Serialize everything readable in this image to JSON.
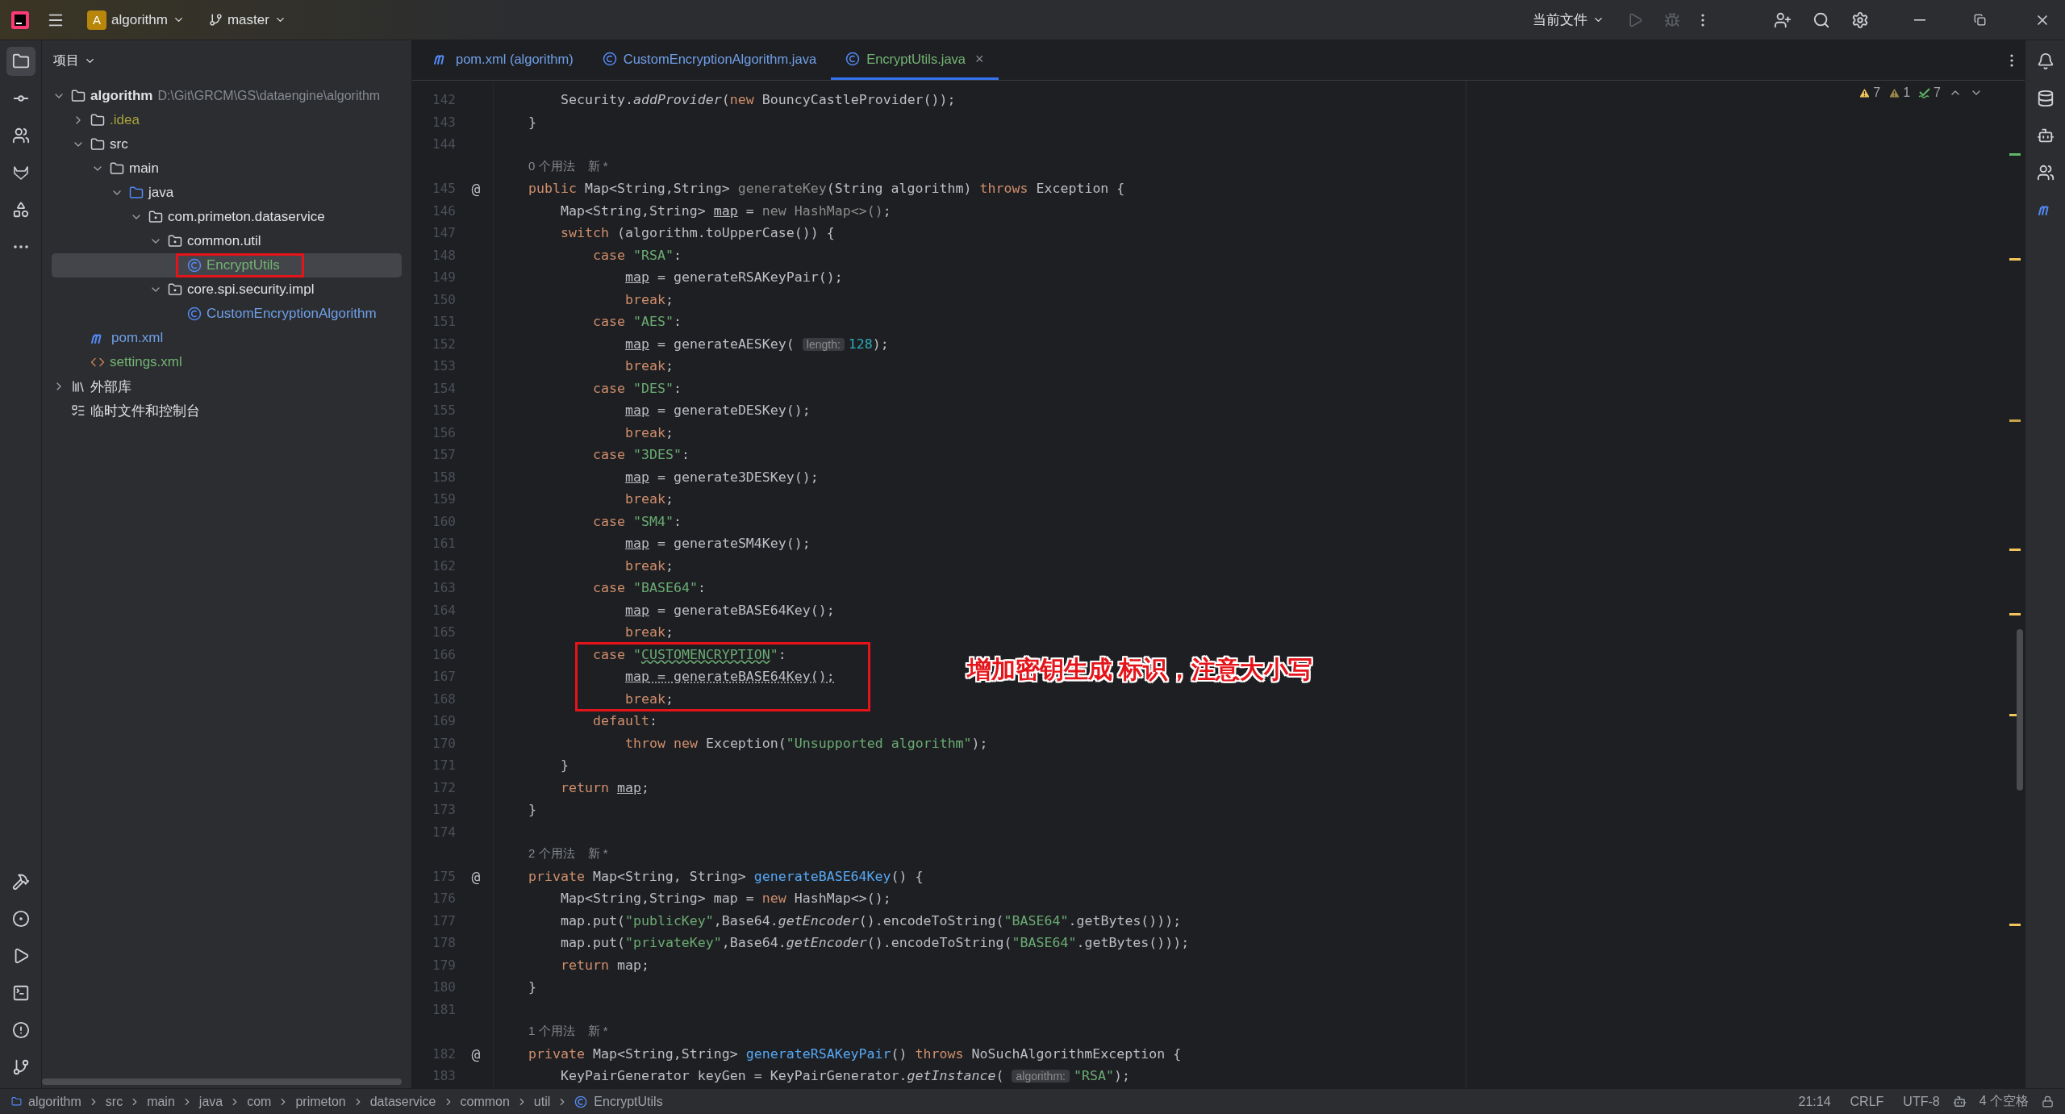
{
  "title_bar": {
    "project_badge": "A",
    "project": "algorithm",
    "branch": "master",
    "run_config": "当前文件"
  },
  "project_panel": {
    "title": "项目",
    "tree": [
      {
        "name": "algorithm",
        "path": "D:\\Git\\GRCM\\GS\\dataengine\\algorithm",
        "kind": "module",
        "color": "#dfe1e5",
        "expanded": true,
        "selected": false,
        "children": [
          {
            "name": ".idea",
            "kind": "folder",
            "color": "#a8a33e",
            "expanded": false,
            "selected": false
          },
          {
            "name": "src",
            "kind": "folder",
            "color": "#dfe1e5",
            "expanded": true,
            "selected": false,
            "children": [
              {
                "name": "main",
                "kind": "folder",
                "color": "#dfe1e5",
                "expanded": true,
                "selected": false,
                "children": [
                  {
                    "name": "java",
                    "kind": "source",
                    "color": "#dfe1e5",
                    "expanded": true,
                    "selected": false,
                    "children": [
                      {
                        "name": "com.primeton.dataservice",
                        "kind": "package",
                        "color": "#dfe1e5",
                        "expanded": true,
                        "selected": false,
                        "children": [
                          {
                            "name": "common.util",
                            "kind": "package",
                            "color": "#dfe1e5",
                            "expanded": true,
                            "selected": false,
                            "children": [
                              {
                                "name": "EncryptUtils",
                                "kind": "class",
                                "color": "#73b374",
                                "selected": true,
                                "boxed": true
                              }
                            ]
                          },
                          {
                            "name": "core.spi.security.impl",
                            "kind": "package",
                            "color": "#dfe1e5",
                            "expanded": true,
                            "selected": false,
                            "children": [
                              {
                                "name": "CustomEncryptionAlgorithm",
                                "kind": "class",
                                "color": "#6f9fe8",
                                "selected": false
                              }
                            ]
                          }
                        ]
                      }
                    ]
                  }
                ]
              }
            ]
          },
          {
            "name": "pom.xml",
            "kind": "maven",
            "color": "#6f9fe8",
            "selected": false
          },
          {
            "name": "settings.xml",
            "kind": "xml",
            "color": "#73b374",
            "selected": false
          }
        ]
      },
      {
        "name": "外部库",
        "kind": "library",
        "color": "#dfe1e5",
        "expanded": false,
        "selected": false
      },
      {
        "name": "临时文件和控制台",
        "kind": "scratch",
        "color": "#dfe1e5",
        "selected": false
      }
    ]
  },
  "tabs": [
    {
      "label": "pom.xml (algorithm)",
      "kind": "maven",
      "color": "#6f9fe8",
      "selected": false
    },
    {
      "label": "CustomEncryptionAlgorithm.java",
      "kind": "class",
      "color": "#6f9fe8",
      "selected": false
    },
    {
      "label": "EncryptUtils.java",
      "kind": "class",
      "color": "#73b374",
      "selected": true,
      "close": "×"
    }
  ],
  "inspections": [
    {
      "kind": "warning",
      "count": "7"
    },
    {
      "kind": "weak",
      "count": "1"
    },
    {
      "kind": "typo",
      "count": "7"
    }
  ],
  "code": [
    {
      "kind": "block",
      "children": [
        {
          "kind": "line",
          "number": "142",
          "tokens": [
            {
              "kind": "p",
              "text": "Security."
            },
            {
              "kind": "it",
              "text": "addProvider"
            },
            {
              "kind": "p",
              "text": "("
            },
            {
              "kind": "kw",
              "text": "new"
            },
            {
              "kind": "p",
              "text": " BouncyCastleProvider());"
            }
          ]
        }
      ]
    },
    {
      "kind": "line",
      "number": "143",
      "tokens": [
        {
          "kind": "p",
          "text": "}"
        }
      ]
    },
    {
      "kind": "line",
      "number": "144"
    },
    {
      "kind": "usage",
      "text": "0 个用法",
      "extra": "新 *"
    },
    {
      "kind": "line",
      "number": "145",
      "mark": "@",
      "tokens": [
        {
          "kind": "kw",
          "text": "public"
        },
        {
          "kind": "p",
          "text": " Map<String,String> "
        },
        {
          "kind": "un",
          "text": "generateKey"
        },
        {
          "kind": "p",
          "text": "(String algorithm) "
        },
        {
          "kind": "kw",
          "text": "throws"
        },
        {
          "kind": "p",
          "text": " Exception {"
        }
      ],
      "children": [
        {
          "kind": "line",
          "number": "146",
          "tokens": [
            {
              "kind": "p",
              "text": "Map<String,String> "
            },
            {
              "kind": "var",
              "text": "map"
            },
            {
              "kind": "p",
              "text": " = "
            },
            {
              "kind": "un",
              "text": "new HashMap<>()"
            },
            {
              "kind": "p",
              "text": ";"
            }
          ]
        },
        {
          "kind": "line",
          "number": "147",
          "tokens": [
            {
              "kind": "kw",
              "text": "switch"
            },
            {
              "kind": "p",
              "text": " (algorithm.toUpperCase()) {"
            }
          ],
          "children": [
            {
              "kind": "line",
              "number": "148",
              "tokens": [
                {
                  "kind": "kw",
                  "text": "case"
                },
                {
                  "kind": "str",
                  "text": " \"RSA\""
                },
                {
                  "kind": "p",
                  "text": ":"
                }
              ],
              "children": [
                {
                  "kind": "line",
                  "number": "149",
                  "tokens": [
                    {
                      "kind": "var",
                      "text": "map"
                    },
                    {
                      "kind": "p",
                      "text": " = generateRSAKeyPair();"
                    }
                  ]
                },
                {
                  "kind": "line",
                  "number": "150",
                  "tokens": [
                    {
                      "kind": "kw",
                      "text": "break"
                    },
                    {
                      "kind": "p",
                      "text": ";"
                    }
                  ]
                }
              ]
            },
            {
              "kind": "line",
              "number": "151",
              "tokens": [
                {
                  "kind": "kw",
                  "text": "case"
                },
                {
                  "kind": "str",
                  "text": " \"AES\""
                },
                {
                  "kind": "p",
                  "text": ":"
                }
              ],
              "children": [
                {
                  "kind": "line",
                  "number": "152",
                  "tokens": [
                    {
                      "kind": "var",
                      "text": "map"
                    },
                    {
                      "kind": "p",
                      "text": " = generateAESKey( "
                    },
                    {
                      "kind": "hint",
                      "text": "length:"
                    },
                    {
                      "kind": "num",
                      "text": "128"
                    },
                    {
                      "kind": "p",
                      "text": ");"
                    }
                  ]
                },
                {
                  "kind": "line",
                  "number": "153",
                  "tokens": [
                    {
                      "kind": "kw",
                      "text": "break"
                    },
                    {
                      "kind": "p",
                      "text": ";"
                    }
                  ]
                }
              ]
            },
            {
              "kind": "line",
              "number": "154",
              "tokens": [
                {
                  "kind": "kw",
                  "text": "case"
                },
                {
                  "kind": "str",
                  "text": " \"DES\""
                },
                {
                  "kind": "p",
                  "text": ":"
                }
              ],
              "children": [
                {
                  "kind": "line",
                  "number": "155",
                  "tokens": [
                    {
                      "kind": "var",
                      "text": "map"
                    },
                    {
                      "kind": "p",
                      "text": " = generateDESKey();"
                    }
                  ]
                },
                {
                  "kind": "line",
                  "number": "156",
                  "tokens": [
                    {
                      "kind": "kw",
                      "text": "break"
                    },
                    {
                      "kind": "p",
                      "text": ";"
                    }
                  ]
                }
              ]
            },
            {
              "kind": "line",
              "number": "157",
              "tokens": [
                {
                  "kind": "kw",
                  "text": "case"
                },
                {
                  "kind": "str",
                  "text": " \"3DES\""
                },
                {
                  "kind": "p",
                  "text": ":"
                }
              ],
              "children": [
                {
                  "kind": "line",
                  "number": "158",
                  "tokens": [
                    {
                      "kind": "var",
                      "text": "map"
                    },
                    {
                      "kind": "p",
                      "text": " = generate3DESKey();"
                    }
                  ]
                },
                {
                  "kind": "line",
                  "number": "159",
                  "tokens": [
                    {
                      "kind": "kw",
                      "text": "break"
                    },
                    {
                      "kind": "p",
                      "text": ";"
                    }
                  ]
                }
              ]
            },
            {
              "kind": "line",
              "number": "160",
              "tokens": [
                {
                  "kind": "kw",
                  "text": "case"
                },
                {
                  "kind": "str",
                  "text": " \"SM4\""
                },
                {
                  "kind": "p",
                  "text": ":"
                }
              ],
              "children": [
                {
                  "kind": "line",
                  "number": "161",
                  "tokens": [
                    {
                      "kind": "var",
                      "text": "map"
                    },
                    {
                      "kind": "p",
                      "text": " = generateSM4Key();"
                    }
                  ]
                },
                {
                  "kind": "line",
                  "number": "162",
                  "tokens": [
                    {
                      "kind": "kw",
                      "text": "break"
                    },
                    {
                      "kind": "p",
                      "text": ";"
                    }
                  ]
                }
              ]
            },
            {
              "kind": "line",
              "number": "163",
              "tokens": [
                {
                  "kind": "kw",
                  "text": "case"
                },
                {
                  "kind": "str",
                  "text": " \"BASE64\""
                },
                {
                  "kind": "p",
                  "text": ":"
                }
              ],
              "children": [
                {
                  "kind": "line",
                  "number": "164",
                  "tokens": [
                    {
                      "kind": "var",
                      "text": "map"
                    },
                    {
                      "kind": "p",
                      "text": " = generateBASE64Key();"
                    }
                  ]
                },
                {
                  "kind": "line",
                  "number": "165",
                  "tokens": [
                    {
                      "kind": "kw",
                      "text": "break"
                    },
                    {
                      "kind": "p",
                      "text": ";"
                    }
                  ]
                }
              ]
            },
            {
              "kind": "line",
              "number": "166",
              "boxed": true,
              "tokens": [
                {
                  "kind": "kw",
                  "text": "case"
                },
                {
                  "kind": "str",
                  "text": " \""
                },
                {
                  "kind": "typo",
                  "text": "CUSTOMENCRYPTION"
                },
                {
                  "kind": "str",
                  "text": "\""
                },
                {
                  "kind": "p",
                  "text": ":"
                }
              ],
              "children": [
                {
                  "kind": "line",
                  "number": "167",
                  "tokens": [
                    {
                      "kind": "var",
                      "text": "map"
                    },
                    {
                      "kind": "warn",
                      "text": " = generateBASE64Key();"
                    }
                  ]
                },
                {
                  "kind": "line",
                  "number": "168",
                  "tokens": [
                    {
                      "kind": "kw",
                      "text": "break"
                    },
                    {
                      "kind": "p",
                      "text": ";"
                    }
                  ]
                }
              ]
            },
            {
              "kind": "line",
              "number": "169",
              "tokens": [
                {
                  "kind": "kw",
                  "text": "default"
                },
                {
                  "kind": "p",
                  "text": ":"
                }
              ],
              "children": [
                {
                  "kind": "line",
                  "number": "170",
                  "tokens": [
                    {
                      "kind": "kw",
                      "text": "throw new"
                    },
                    {
                      "kind": "p",
                      "text": " Exception("
                    },
                    {
                      "kind": "str",
                      "text": "\"Unsupported algorithm\""
                    },
                    {
                      "kind": "p",
                      "text": ");"
                    }
                  ]
                }
              ]
            }
          ]
        },
        {
          "kind": "line",
          "number": "171",
          "tokens": [
            {
              "kind": "p",
              "text": "}"
            }
          ]
        },
        {
          "kind": "line",
          "number": "172",
          "tokens": [
            {
              "kind": "kw",
              "text": "return "
            },
            {
              "kind": "var",
              "text": "map"
            },
            {
              "kind": "p",
              "text": ";"
            }
          ]
        }
      ]
    },
    {
      "kind": "line",
      "number": "173",
      "tokens": [
        {
          "kind": "p",
          "text": "}"
        }
      ]
    },
    {
      "kind": "line",
      "number": "174"
    },
    {
      "kind": "usage",
      "text": "2 个用法",
      "extra": "新 *"
    },
    {
      "kind": "line",
      "number": "175",
      "mark": "@",
      "tokens": [
        {
          "kind": "kw",
          "text": "private"
        },
        {
          "kind": "p",
          "text": " Map<String, String> "
        },
        {
          "kind": "fn",
          "text": "generateBASE64Key"
        },
        {
          "kind": "p",
          "text": "() {"
        }
      ],
      "children": [
        {
          "kind": "line",
          "number": "176",
          "tokens": [
            {
              "kind": "p",
              "text": "Map<String,String> map = "
            },
            {
              "kind": "kw",
              "text": "new"
            },
            {
              "kind": "p",
              "text": " HashMap<>();"
            }
          ]
        },
        {
          "kind": "line",
          "number": "177",
          "tokens": [
            {
              "kind": "p",
              "text": "map.put("
            },
            {
              "kind": "str",
              "text": "\"publicKey\""
            },
            {
              "kind": "p",
              "text": ",Base64."
            },
            {
              "kind": "it",
              "text": "getEncoder"
            },
            {
              "kind": "p",
              "text": "().encodeToString("
            },
            {
              "kind": "str",
              "text": "\"BASE64\""
            },
            {
              "kind": "p",
              "text": ".getBytes()));"
            }
          ]
        },
        {
          "kind": "line",
          "number": "178",
          "tokens": [
            {
              "kind": "p",
              "text": "map.put("
            },
            {
              "kind": "str",
              "text": "\"privateKey\""
            },
            {
              "kind": "p",
              "text": ",Base64."
            },
            {
              "kind": "it",
              "text": "getEncoder"
            },
            {
              "kind": "p",
              "text": "().encodeToString("
            },
            {
              "kind": "str",
              "text": "\"BASE64\""
            },
            {
              "kind": "p",
              "text": ".getBytes()));"
            }
          ]
        },
        {
          "kind": "line",
          "number": "179",
          "tokens": [
            {
              "kind": "kw",
              "text": "return"
            },
            {
              "kind": "p",
              "text": " map;"
            }
          ]
        }
      ]
    },
    {
      "kind": "line",
      "number": "180",
      "tokens": [
        {
          "kind": "p",
          "text": "}"
        }
      ]
    },
    {
      "kind": "line",
      "number": "181"
    },
    {
      "kind": "usage",
      "text": "1 个用法",
      "extra": "新 *"
    },
    {
      "kind": "line",
      "number": "182",
      "mark": "@",
      "tokens": [
        {
          "kind": "kw",
          "text": "private"
        },
        {
          "kind": "p",
          "text": " Map<String,String> "
        },
        {
          "kind": "fn",
          "text": "generateRSAKeyPair"
        },
        {
          "kind": "p",
          "text": "() "
        },
        {
          "kind": "kw",
          "text": "throws"
        },
        {
          "kind": "p",
          "text": " NoSuchAlgorithmException {"
        }
      ],
      "children": [
        {
          "kind": "line",
          "number": "183",
          "tokens": [
            {
              "kind": "p",
              "text": "KeyPairGenerator keyGen = KeyPairGenerator."
            },
            {
              "kind": "it",
              "text": "getInstance"
            },
            {
              "kind": "p",
              "text": "( "
            },
            {
              "kind": "hint",
              "text": "algorithm:"
            },
            {
              "kind": "str",
              "text": "\"RSA\""
            },
            {
              "kind": "p",
              "text": ");"
            }
          ]
        }
      ]
    }
  ],
  "annotation": "增加密钥生成 标识，注意大小写",
  "breadcrumbs": [
    {
      "label": "algorithm",
      "kind": "module"
    },
    {
      "label": "src"
    },
    {
      "label": "main"
    },
    {
      "label": "java"
    },
    {
      "label": "com"
    },
    {
      "label": "primeton"
    },
    {
      "label": "dataservice"
    },
    {
      "label": "common"
    },
    {
      "label": "util"
    },
    {
      "label": "EncryptUtils",
      "kind": "class"
    }
  ],
  "status": {
    "position": "21:14",
    "line_ending": "CRLF",
    "encoding": "UTF-8",
    "indent": "4 个空格"
  }
}
